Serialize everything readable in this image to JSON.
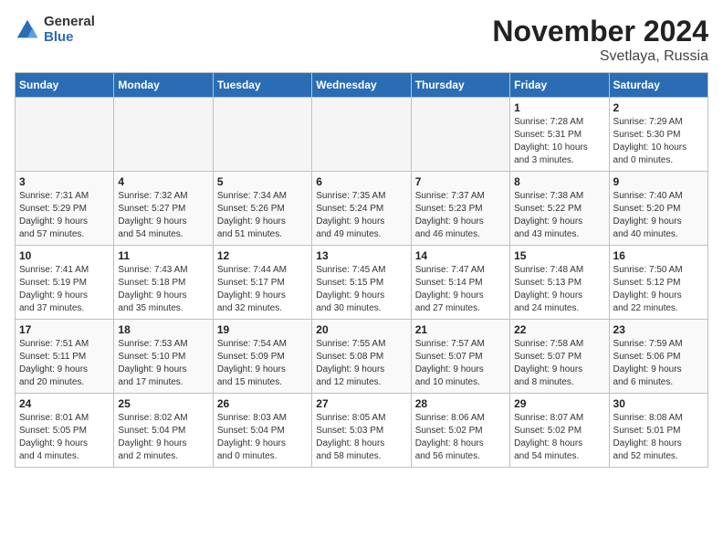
{
  "logo": {
    "general": "General",
    "blue": "Blue"
  },
  "title": "November 2024",
  "location": "Svetlaya, Russia",
  "weekdays": [
    "Sunday",
    "Monday",
    "Tuesday",
    "Wednesday",
    "Thursday",
    "Friday",
    "Saturday"
  ],
  "weeks": [
    [
      {
        "day": "",
        "info": ""
      },
      {
        "day": "",
        "info": ""
      },
      {
        "day": "",
        "info": ""
      },
      {
        "day": "",
        "info": ""
      },
      {
        "day": "",
        "info": ""
      },
      {
        "day": "1",
        "info": "Sunrise: 7:28 AM\nSunset: 5:31 PM\nDaylight: 10 hours\nand 3 minutes."
      },
      {
        "day": "2",
        "info": "Sunrise: 7:29 AM\nSunset: 5:30 PM\nDaylight: 10 hours\nand 0 minutes."
      }
    ],
    [
      {
        "day": "3",
        "info": "Sunrise: 7:31 AM\nSunset: 5:29 PM\nDaylight: 9 hours\nand 57 minutes."
      },
      {
        "day": "4",
        "info": "Sunrise: 7:32 AM\nSunset: 5:27 PM\nDaylight: 9 hours\nand 54 minutes."
      },
      {
        "day": "5",
        "info": "Sunrise: 7:34 AM\nSunset: 5:26 PM\nDaylight: 9 hours\nand 51 minutes."
      },
      {
        "day": "6",
        "info": "Sunrise: 7:35 AM\nSunset: 5:24 PM\nDaylight: 9 hours\nand 49 minutes."
      },
      {
        "day": "7",
        "info": "Sunrise: 7:37 AM\nSunset: 5:23 PM\nDaylight: 9 hours\nand 46 minutes."
      },
      {
        "day": "8",
        "info": "Sunrise: 7:38 AM\nSunset: 5:22 PM\nDaylight: 9 hours\nand 43 minutes."
      },
      {
        "day": "9",
        "info": "Sunrise: 7:40 AM\nSunset: 5:20 PM\nDaylight: 9 hours\nand 40 minutes."
      }
    ],
    [
      {
        "day": "10",
        "info": "Sunrise: 7:41 AM\nSunset: 5:19 PM\nDaylight: 9 hours\nand 37 minutes."
      },
      {
        "day": "11",
        "info": "Sunrise: 7:43 AM\nSunset: 5:18 PM\nDaylight: 9 hours\nand 35 minutes."
      },
      {
        "day": "12",
        "info": "Sunrise: 7:44 AM\nSunset: 5:17 PM\nDaylight: 9 hours\nand 32 minutes."
      },
      {
        "day": "13",
        "info": "Sunrise: 7:45 AM\nSunset: 5:15 PM\nDaylight: 9 hours\nand 30 minutes."
      },
      {
        "day": "14",
        "info": "Sunrise: 7:47 AM\nSunset: 5:14 PM\nDaylight: 9 hours\nand 27 minutes."
      },
      {
        "day": "15",
        "info": "Sunrise: 7:48 AM\nSunset: 5:13 PM\nDaylight: 9 hours\nand 24 minutes."
      },
      {
        "day": "16",
        "info": "Sunrise: 7:50 AM\nSunset: 5:12 PM\nDaylight: 9 hours\nand 22 minutes."
      }
    ],
    [
      {
        "day": "17",
        "info": "Sunrise: 7:51 AM\nSunset: 5:11 PM\nDaylight: 9 hours\nand 20 minutes."
      },
      {
        "day": "18",
        "info": "Sunrise: 7:53 AM\nSunset: 5:10 PM\nDaylight: 9 hours\nand 17 minutes."
      },
      {
        "day": "19",
        "info": "Sunrise: 7:54 AM\nSunset: 5:09 PM\nDaylight: 9 hours\nand 15 minutes."
      },
      {
        "day": "20",
        "info": "Sunrise: 7:55 AM\nSunset: 5:08 PM\nDaylight: 9 hours\nand 12 minutes."
      },
      {
        "day": "21",
        "info": "Sunrise: 7:57 AM\nSunset: 5:07 PM\nDaylight: 9 hours\nand 10 minutes."
      },
      {
        "day": "22",
        "info": "Sunrise: 7:58 AM\nSunset: 5:07 PM\nDaylight: 9 hours\nand 8 minutes."
      },
      {
        "day": "23",
        "info": "Sunrise: 7:59 AM\nSunset: 5:06 PM\nDaylight: 9 hours\nand 6 minutes."
      }
    ],
    [
      {
        "day": "24",
        "info": "Sunrise: 8:01 AM\nSunset: 5:05 PM\nDaylight: 9 hours\nand 4 minutes."
      },
      {
        "day": "25",
        "info": "Sunrise: 8:02 AM\nSunset: 5:04 PM\nDaylight: 9 hours\nand 2 minutes."
      },
      {
        "day": "26",
        "info": "Sunrise: 8:03 AM\nSunset: 5:04 PM\nDaylight: 9 hours\nand 0 minutes."
      },
      {
        "day": "27",
        "info": "Sunrise: 8:05 AM\nSunset: 5:03 PM\nDaylight: 8 hours\nand 58 minutes."
      },
      {
        "day": "28",
        "info": "Sunrise: 8:06 AM\nSunset: 5:02 PM\nDaylight: 8 hours\nand 56 minutes."
      },
      {
        "day": "29",
        "info": "Sunrise: 8:07 AM\nSunset: 5:02 PM\nDaylight: 8 hours\nand 54 minutes."
      },
      {
        "day": "30",
        "info": "Sunrise: 8:08 AM\nSunset: 5:01 PM\nDaylight: 8 hours\nand 52 minutes."
      }
    ]
  ]
}
